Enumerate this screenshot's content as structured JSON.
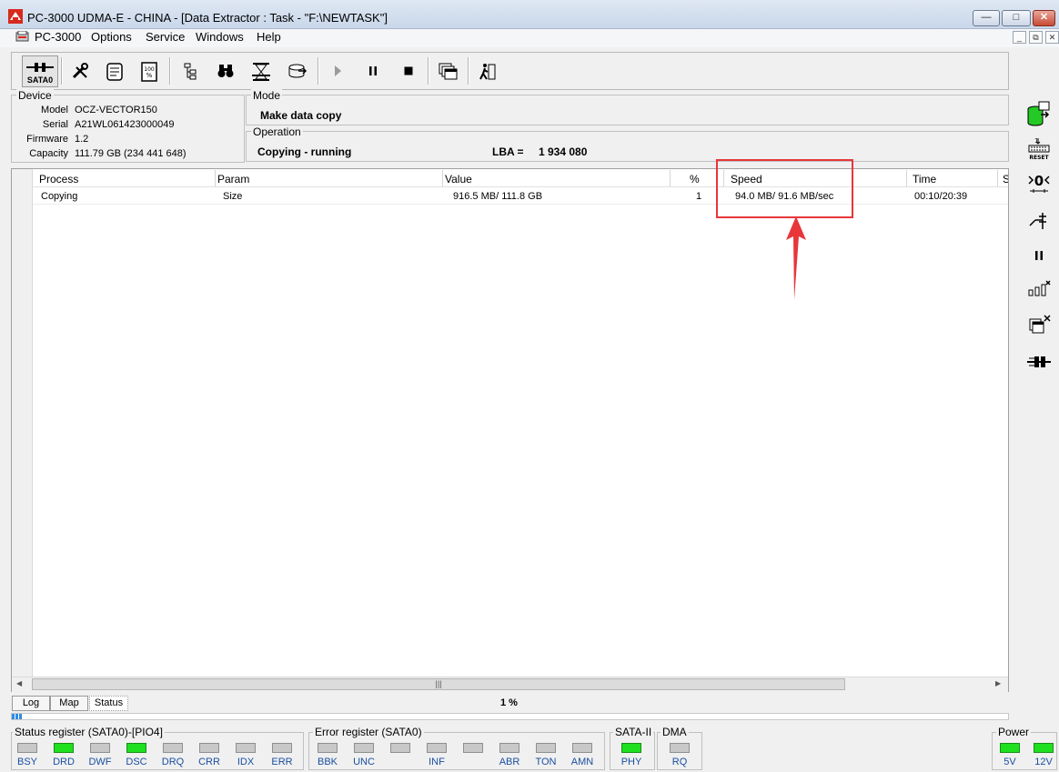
{
  "window": {
    "title": "PC-3000 UDMA-E - CHINA - [Data Extractor : Task - \"F:\\NEWTASK\"]",
    "controls": {
      "minimize": "—",
      "maximize": "□",
      "close": "✕"
    }
  },
  "menu": {
    "items": [
      "PC-3000",
      "Options",
      "Service",
      "Windows",
      "Help"
    ],
    "mdi_controls": [
      "_",
      "⧉",
      "✕"
    ]
  },
  "toolbar": {
    "port_label": "SATA0",
    "buttons": [
      "tools-icon",
      "scroll-icon",
      "percent-icon",
      "tree-icon",
      "binoculars-icon",
      "hourglass-icon",
      "export-icon",
      "play-icon",
      "pause-icon",
      "stop-icon",
      "windows-icon",
      "exit-icon"
    ]
  },
  "device": {
    "group_label": "Device",
    "model_label": "Model",
    "model": "OCZ-VECTOR150",
    "serial_label": "Serial",
    "serial": "A21WL061423000049",
    "firmware_label": "Firmware",
    "firmware": "1.2",
    "capacity_label": "Capacity",
    "capacity": "111.79 GB (234 441 648)"
  },
  "mode": {
    "group_label": "Mode",
    "value": "Make data copy"
  },
  "operation": {
    "group_label": "Operation",
    "status": "Copying - running",
    "lba_label": "LBA =",
    "lba": "1 934 080"
  },
  "table": {
    "columns": [
      "Process",
      "Param",
      "Value",
      "%",
      "Speed",
      "Time",
      "S"
    ],
    "rows": [
      {
        "process": "Copying",
        "param": "Size",
        "value": "916.5 MB/ 111.8 GB",
        "percent": "1",
        "speed": "94.0 MB/ 91.6 MB/sec",
        "time": "00:10/20:39"
      }
    ]
  },
  "tabs": [
    "Log",
    "Map",
    "Status"
  ],
  "active_tab": "Status",
  "progress": {
    "text": "1 %",
    "value": 0.01
  },
  "status_register": {
    "label": "Status register (SATA0)-[PIO4]",
    "flags": [
      {
        "name": "BSY",
        "on": false
      },
      {
        "name": "DRD",
        "on": true
      },
      {
        "name": "DWF",
        "on": false
      },
      {
        "name": "DSC",
        "on": true
      },
      {
        "name": "DRQ",
        "on": false
      },
      {
        "name": "CRR",
        "on": false
      },
      {
        "name": "IDX",
        "on": false
      },
      {
        "name": "ERR",
        "on": false
      }
    ]
  },
  "error_register": {
    "label": "Error register (SATA0)",
    "flags": [
      {
        "name": "BBK",
        "on": false
      },
      {
        "name": "UNC",
        "on": false
      },
      {
        "name": "",
        "on": false
      },
      {
        "name": "INF",
        "on": false
      },
      {
        "name": "",
        "on": false
      },
      {
        "name": "ABR",
        "on": false
      },
      {
        "name": "TON",
        "on": false
      },
      {
        "name": "AMN",
        "on": false
      }
    ]
  },
  "sata2": {
    "label": "SATA-II",
    "flag": "PHY",
    "on": true
  },
  "dma": {
    "label": "DMA",
    "flag": "RQ",
    "on": false
  },
  "power": {
    "label": "Power",
    "flags": [
      {
        "name": "5V",
        "on": true
      },
      {
        "name": "12V",
        "on": true
      }
    ]
  },
  "sidebar": {
    "icons": [
      "database-icon",
      "reset-icon",
      "head-icon",
      "wiring-icon",
      "pause-icon",
      "graph-icon",
      "close-windows-icon",
      "connector-icon"
    ],
    "reset_label": "RESET"
  },
  "colors": {
    "highlight": "#e8363a",
    "led_on": "#1fe01f",
    "flag_text": "#1a4fa0"
  }
}
